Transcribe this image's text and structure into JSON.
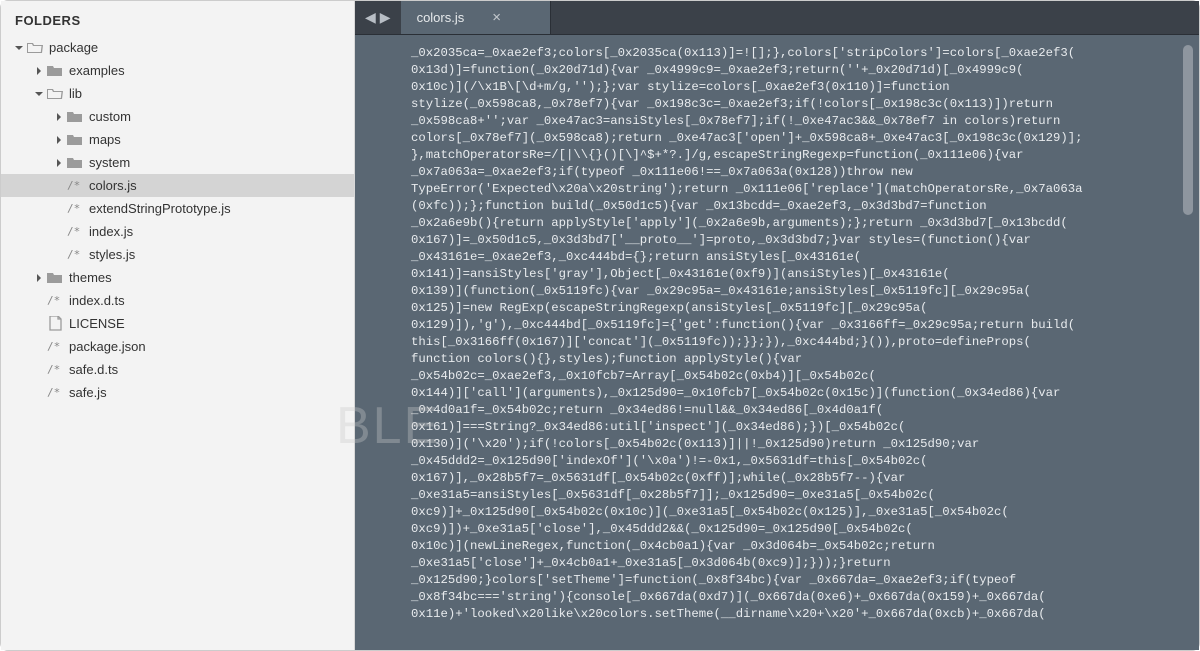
{
  "sidebar": {
    "header": "FOLDERS",
    "items": [
      {
        "depth": 0,
        "arrow": "down",
        "icon": "folder-open",
        "label": "package"
      },
      {
        "depth": 1,
        "arrow": "right",
        "icon": "folder",
        "label": "examples"
      },
      {
        "depth": 1,
        "arrow": "down",
        "icon": "folder-open",
        "label": "lib"
      },
      {
        "depth": 2,
        "arrow": "right",
        "icon": "folder",
        "label": "custom"
      },
      {
        "depth": 2,
        "arrow": "right",
        "icon": "folder",
        "label": "maps"
      },
      {
        "depth": 2,
        "arrow": "right",
        "icon": "folder",
        "label": "system"
      },
      {
        "depth": 2,
        "arrow": "",
        "icon": "js",
        "label": "colors.js",
        "selected": true
      },
      {
        "depth": 2,
        "arrow": "",
        "icon": "js",
        "label": "extendStringPrototype.js"
      },
      {
        "depth": 2,
        "arrow": "",
        "icon": "js",
        "label": "index.js"
      },
      {
        "depth": 2,
        "arrow": "",
        "icon": "js",
        "label": "styles.js"
      },
      {
        "depth": 1,
        "arrow": "right",
        "icon": "folder",
        "label": "themes"
      },
      {
        "depth": 1,
        "arrow": "",
        "icon": "js",
        "label": "index.d.ts"
      },
      {
        "depth": 1,
        "arrow": "",
        "icon": "file",
        "label": "LICENSE"
      },
      {
        "depth": 1,
        "arrow": "",
        "icon": "js",
        "label": "package.json"
      },
      {
        "depth": 1,
        "arrow": "",
        "icon": "js",
        "label": "safe.d.ts"
      },
      {
        "depth": 1,
        "arrow": "",
        "icon": "js",
        "label": "safe.js"
      }
    ]
  },
  "tab": {
    "title": "colors.js"
  },
  "code_lines": [
    "_0x2035ca=_0xae2ef3;colors[_0x2035ca(0x113)]=![];},colors['stripColors']=colors[_0xae2ef3(",
    "0x13d)]=function(_0x20d71d){var _0x4999c9=_0xae2ef3;return(''+_0x20d71d)[_0x4999c9(",
    "0x10c)](/\\x1B\\[\\d+m/g,'');};var stylize=colors[_0xae2ef3(0x110)]=function",
    "stylize(_0x598ca8,_0x78ef7){var _0x198c3c=_0xae2ef3;if(!colors[_0x198c3c(0x113)])return",
    "_0x598ca8+'';var _0xe47ac3=ansiStyles[_0x78ef7];if(!_0xe47ac3&&_0x78ef7 in colors)return",
    "colors[_0x78ef7](_0x598ca8);return _0xe47ac3['open']+_0x598ca8+_0xe47ac3[_0x198c3c(0x129)];",
    "},matchOperatorsRe=/[|\\\\{}()[\\]^$+*?.]/g,escapeStringRegexp=function(_0x111e06){var",
    "_0x7a063a=_0xae2ef3;if(typeof _0x111e06!==_0x7a063a(0x128))throw new",
    "TypeError('Expected\\x20a\\x20string');return _0x111e06['replace'](matchOperatorsRe,_0x7a063a",
    "(0xfc));};function build(_0x50d1c5){var _0x13bcdd=_0xae2ef3,_0x3d3bd7=function",
    "_0x2a6e9b(){return applyStyle['apply'](_0x2a6e9b,arguments);};return _0x3d3bd7[_0x13bcdd(",
    "0x167)]=_0x50d1c5,_0x3d3bd7['__proto__']=proto,_0x3d3bd7;}var styles=(function(){var",
    "_0x43161e=_0xae2ef3,_0xc444bd={};return ansiStyles[_0x43161e(",
    "0x141)]=ansiStyles['gray'],Object[_0x43161e(0xf9)](ansiStyles)[_0x43161e(",
    "0x139)](function(_0x5119fc){var _0x29c95a=_0x43161e;ansiStyles[_0x5119fc][_0x29c95a(",
    "0x125)]=new RegExp(escapeStringRegexp(ansiStyles[_0x5119fc][_0x29c95a(",
    "0x129)]),'g'),_0xc444bd[_0x5119fc]={'get':function(){var _0x3166ff=_0x29c95a;return build(",
    "this[_0x3166ff(0x167)]['concat'](_0x5119fc));}};}),_0xc444bd;}()),proto=defineProps(",
    "function colors(){},styles);function applyStyle(){var",
    "_0x54b02c=_0xae2ef3,_0x10fcb7=Array[_0x54b02c(0xb4)][_0x54b02c(",
    "0x144)]['call'](arguments),_0x125d90=_0x10fcb7[_0x54b02c(0x15c)](function(_0x34ed86){var",
    "_0x4d0a1f=_0x54b02c;return _0x34ed86!=null&&_0x34ed86[_0x4d0a1f(",
    "0x161)]===String?_0x34ed86:util['inspect'](_0x34ed86);})[_0x54b02c(",
    "0x130)]('\\x20');if(!colors[_0x54b02c(0x113)]||!_0x125d90)return _0x125d90;var",
    "_0x45ddd2=_0x125d90['indexOf']('\\x0a')!=-0x1,_0x5631df=this[_0x54b02c(",
    "0x167)],_0x28b5f7=_0x5631df[_0x54b02c(0xff)];while(_0x28b5f7--){var",
    "_0xe31a5=ansiStyles[_0x5631df[_0x28b5f7]];_0x125d90=_0xe31a5[_0x54b02c(",
    "0xc9)]+_0x125d90[_0x54b02c(0x10c)](_0xe31a5[_0x54b02c(0x125)],_0xe31a5[_0x54b02c(",
    "0xc9)])+_0xe31a5['close'],_0x45ddd2&&(_0x125d90=_0x125d90[_0x54b02c(",
    "0x10c)](newLineRegex,function(_0x4cb0a1){var _0x3d064b=_0x54b02c;return",
    "_0xe31a5['close']+_0x4cb0a1+_0xe31a5[_0x3d064b(0xc9)];}));}return",
    "_0x125d90;}colors['setTheme']=function(_0x8f34bc){var _0x667da=_0xae2ef3;if(typeof",
    "_0x8f34bc==='string'){console[_0x667da(0xd7)](_0x667da(0xe6)+_0x667da(0x159)+_0x667da(",
    "0x11e)+'looked\\x20like\\x20colors.setTheme(__dirname\\x20+\\x20'+_0x667da(0xcb)+_0x667da("
  ],
  "watermark": "BLE"
}
